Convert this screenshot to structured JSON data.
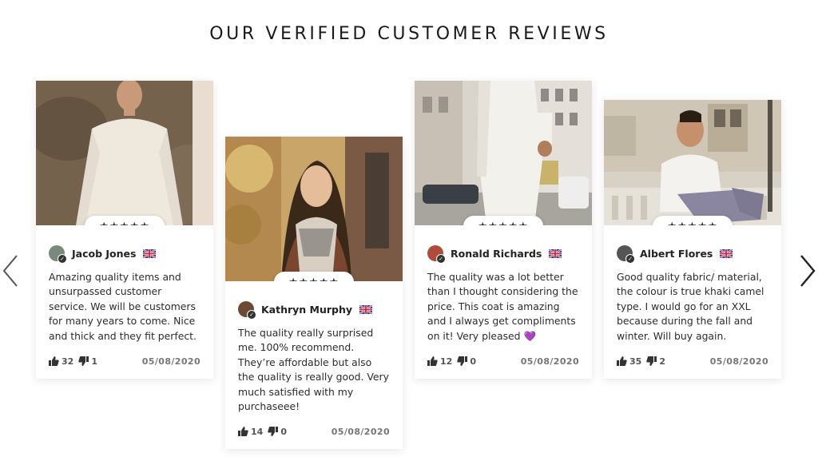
{
  "page": {
    "title": "OUR VERIFIED CUSTOMER REVIEWS"
  },
  "carousel": {
    "prev_icon": "chevron-left-icon",
    "next_icon": "chevron-right-icon"
  },
  "reviews": [
    {
      "name": "Jacob Jones",
      "rating": 5,
      "stars": "★★★★★",
      "text": "Amazing quality items and unsurpassed customer service. We will be customers for many years to come. Nice and thick and they fit perfect.",
      "likes": "32",
      "dislikes": "1",
      "date": "05/08/2020"
    },
    {
      "name": "Kathryn Murphy",
      "rating": 5,
      "stars": "★★★★★",
      "text": "The quality really surprised me. 100% recommend. They’re affordable but also the quality is really good. Very much satisfied with my purchaseee!",
      "likes": "14",
      "dislikes": "0",
      "date": "05/08/2020"
    },
    {
      "name": "Ronald Richards",
      "rating": 5,
      "stars": "★★★★★",
      "text": "The quality was a lot better than I thought considering the price. This coat is amazing and I always get compliments on it! Very pleased 💜",
      "likes": "12",
      "dislikes": "0",
      "date": "05/08/2020"
    },
    {
      "name": "Albert Flores",
      "rating": 5,
      "stars": "★★★★★",
      "text": "Good quality fabric/ material, the colour is true khaki camel type. I would go for an XXL because during the fall and winter. Will buy again.",
      "likes": "35",
      "dislikes": "2",
      "date": "05/08/2020"
    }
  ],
  "colors": {
    "text": "#2a2a2a",
    "date": "#777777",
    "heart": "#9b59d0"
  }
}
